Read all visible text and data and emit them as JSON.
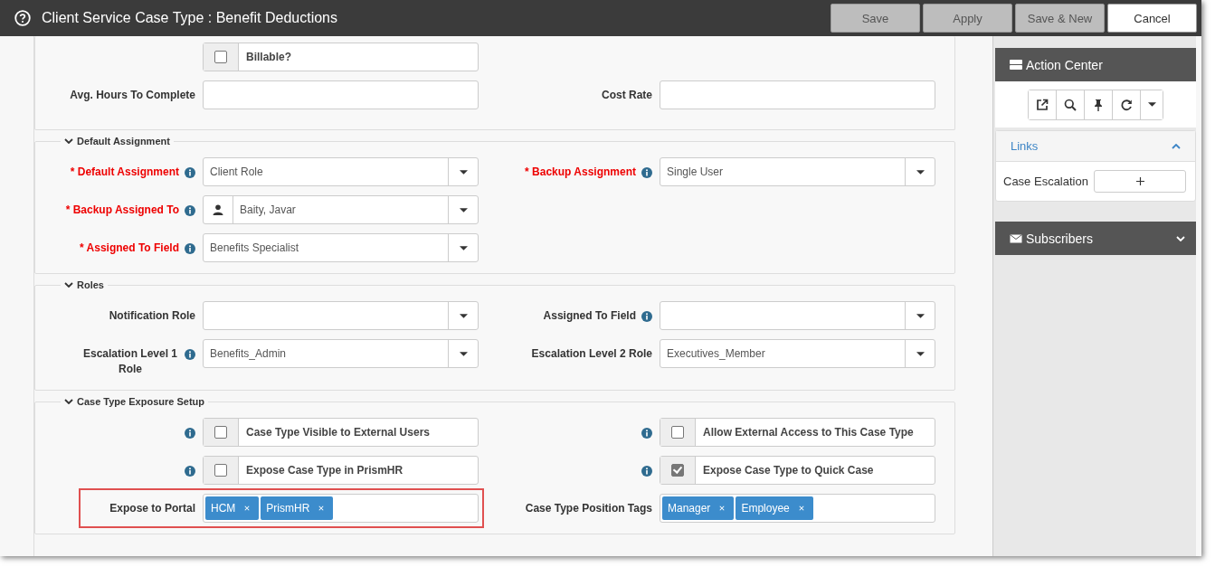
{
  "window": {
    "title": "Client Service Case Type : Benefit Deductions"
  },
  "buttons": [
    {
      "label": "Save",
      "kind": "secondary"
    },
    {
      "label": "Apply",
      "kind": "secondary"
    },
    {
      "label": "Save & New",
      "kind": "secondary"
    },
    {
      "label": "Cancel",
      "kind": "primary"
    }
  ],
  "sections": [
    {
      "rows": [
        {
          "fields": [
            {
              "kind": "checkbox",
              "text": "Billable?",
              "checked": false
            }
          ]
        },
        {
          "fields": [
            {
              "kind": "text",
              "label": "Avg. Hours To Complete"
            },
            {
              "kind": "text",
              "label": "Cost Rate"
            }
          ]
        }
      ]
    },
    {
      "title": "Default Assignment",
      "expanded": true,
      "rows": [
        {
          "fields": [
            {
              "kind": "select",
              "label": "* Default Assignment",
              "required": true,
              "info": true,
              "value": "Client Role"
            },
            {
              "kind": "select",
              "label": "* Backup Assignment",
              "required": true,
              "info": true,
              "value": "Single User"
            }
          ]
        },
        {
          "fields": [
            {
              "kind": "user",
              "label": "* Backup Assigned To",
              "required": true,
              "info": true,
              "value": "Baity, Javar"
            }
          ]
        },
        {
          "fields": [
            {
              "kind": "select",
              "label": "* Assigned To Field",
              "required": true,
              "info": true,
              "value": "Benefits Specialist"
            }
          ]
        }
      ]
    },
    {
      "title": "Roles",
      "expanded": true,
      "rows": [
        {
          "fields": [
            {
              "kind": "select",
              "label": "Notification Role"
            },
            {
              "kind": "select",
              "label": "Assigned To Field",
              "info": true
            }
          ]
        },
        {
          "fields": [
            {
              "kind": "select",
              "label": "Escalation Level 1 Role",
              "info": true,
              "value": "Benefits_Admin"
            },
            {
              "kind": "select",
              "label": "Escalation Level 2 Role",
              "value": "Executives_Member"
            }
          ]
        }
      ]
    },
    {
      "title": "Case Type Exposure Setup",
      "expanded": true,
      "rows": [
        {
          "fields": [
            {
              "kind": "checkbox",
              "info": true,
              "text": "Case Type Visible to External Users",
              "checked": false
            },
            {
              "kind": "checkbox",
              "info": true,
              "text": "Allow External Access to This Case Type",
              "checked": false
            }
          ]
        },
        {
          "fields": [
            {
              "kind": "checkbox",
              "info": true,
              "text": "Expose Case Type in PrismHR",
              "checked": false
            },
            {
              "kind": "checkbox",
              "info": true,
              "text": "Expose Case Type to Quick Case",
              "checked": true
            }
          ]
        },
        {
          "fields": [
            {
              "kind": "tags",
              "label": "Expose to Portal",
              "highlighted": true,
              "tags": [
                "HCM",
                "PrismHR"
              ]
            },
            {
              "kind": "tags",
              "label": "Case Type Position Tags",
              "tags": [
                "Manager",
                "Employee"
              ]
            }
          ]
        }
      ]
    }
  ],
  "side_panel": {
    "action_center": {
      "title": "Action Center"
    },
    "links": {
      "title": "Links",
      "expanded": true,
      "items": [
        {
          "label": "Case Escalation"
        }
      ]
    },
    "subscribers": {
      "title": "Subscribers",
      "expanded": false
    }
  }
}
